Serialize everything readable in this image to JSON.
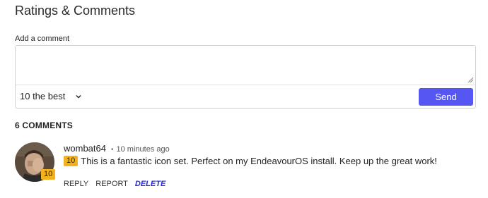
{
  "section": {
    "title": "Ratings & Comments",
    "add_comment_label": "Add a comment",
    "textarea_value": "",
    "rating_selected": "10 the best",
    "send_label": "Send",
    "comments_count": "6 COMMENTS"
  },
  "colors": {
    "accent": "#5656f2",
    "badge": "#f3b21b",
    "delete_link": "#2a2ad8"
  },
  "comments": [
    {
      "avatar_badge": "10",
      "author": "wombat64",
      "separator": "•",
      "time": "10 minutes ago",
      "rating": "10",
      "text": "This is a fantastic icon set. Perfect on my EndeavourOS install. Keep up the great work!",
      "reply_label": "REPLY",
      "report_label": "REPORT",
      "delete_label": "DELETE"
    }
  ]
}
